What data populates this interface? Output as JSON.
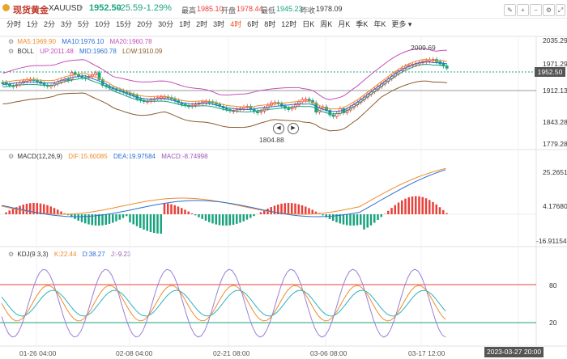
{
  "header": {
    "title": "现货黄金",
    "symbol": "XAUUSD",
    "price": "1952.50",
    "change": "-25.59",
    "change_pct": "-1.29%",
    "high_label": "最高",
    "high": "1985.10",
    "open_label": "开盘",
    "open": "1978.44",
    "low_label": "最低",
    "low": "1945.23",
    "prev_label": "昨收",
    "prev": "1978.09"
  },
  "timeframes": [
    "分时",
    "1分",
    "2分",
    "3分",
    "5分",
    "10分",
    "15分",
    "20分",
    "30分",
    "1时",
    "2时",
    "3时",
    "4时",
    "6时",
    "8时",
    "12时",
    "日K",
    "周K",
    "月K",
    "季K",
    "年K",
    "更多"
  ],
  "active_timeframe_index": 12,
  "main": {
    "ma_label": "MA5:1969.90",
    "ma10_label": "MA10:1976.10",
    "ma20_label": "MA20:1960.78",
    "boll_name": "BOLL",
    "boll_up": "UP:2011.48",
    "boll_mid": "MID:1960.78",
    "boll_low": "LOW:1910.09",
    "price_axis": [
      "2035.29",
      "1971.29",
      "1912.13",
      "1843.28",
      "1779.28"
    ],
    "current_price_tag": "1952.50",
    "high_marker": "2009.69",
    "low_marker": "1804.88"
  },
  "macd": {
    "name": "MACD(12,26,9)",
    "dif": "DIF:15.60085",
    "dea": "DEA:19.97584",
    "macd": "MACD:-8.74998",
    "axis": [
      "25.26514",
      "4.17680",
      "-16.91154"
    ]
  },
  "kdj": {
    "name": "KDJ(9,3,3)",
    "k": "K:22.44",
    "d": "D:38.27",
    "j": "J:-9.23",
    "axis": [
      "80",
      "20"
    ]
  },
  "x_axis": [
    "01-26 04:00",
    "02-08 04:00",
    "02-21 08:00",
    "03-06 08:00",
    "03-17 12:00"
  ],
  "crosshair_time": "2023-03-27 20:00",
  "colors": {
    "up": "#e8403a",
    "down": "#1aa37f",
    "accent": "#e8571d",
    "ma5": "#f08c2c",
    "ma10": "#2b6fd6",
    "ma20": "#c44fb8",
    "boll_up": "#c44fb8",
    "boll_low": "#8b5a2b"
  }
}
